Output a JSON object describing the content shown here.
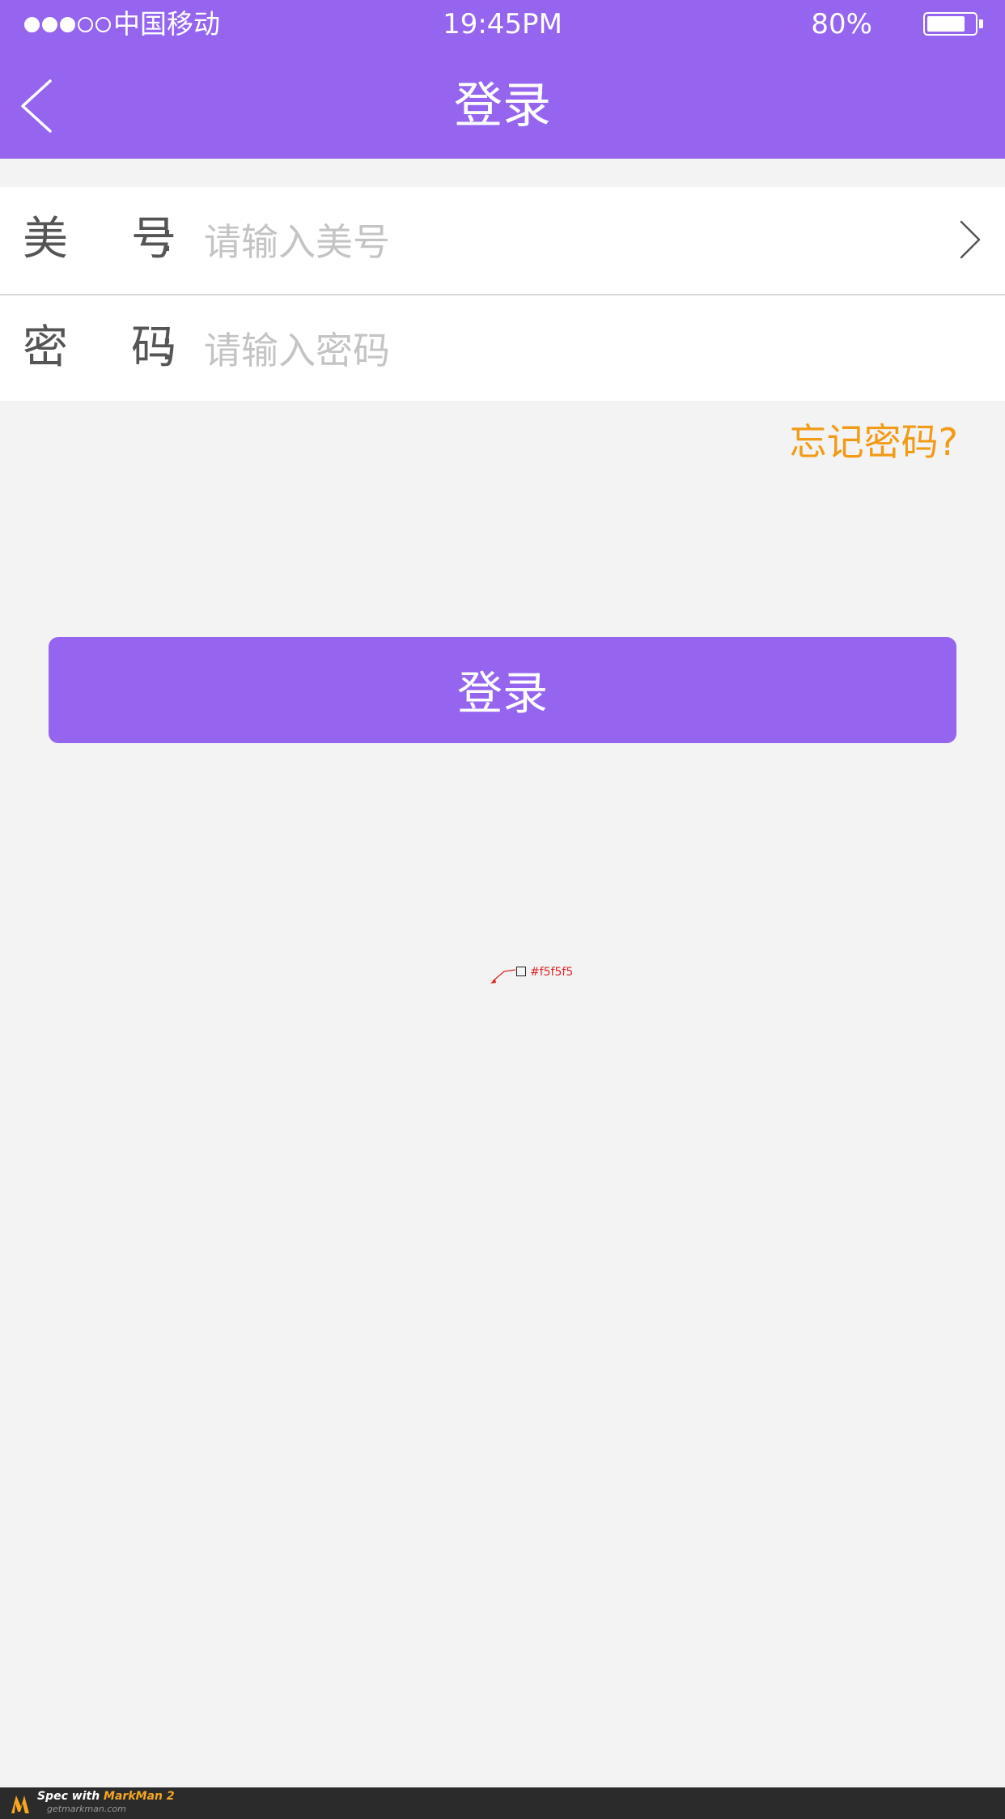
{
  "status_bar": {
    "signal_dots": "●●●○○",
    "carrier": "中国移动",
    "time": "19:45PM",
    "battery_text": "80%",
    "battery_level": 0.8
  },
  "nav": {
    "title": "登录",
    "back_icon": "chevron-left-icon"
  },
  "form": {
    "account": {
      "label_chars": [
        "美",
        "号"
      ],
      "colon": ":",
      "placeholder": "请输入美号",
      "trailing_icon": "chevron-right-icon"
    },
    "password": {
      "label_chars": [
        "密",
        "码"
      ],
      "colon": ":",
      "placeholder": "请输入密码"
    }
  },
  "forgot_password": "忘记密码?",
  "login_button": "登录",
  "spec_annotation": {
    "color_label": "#f5f5f5"
  },
  "footer": {
    "spec_prefix": "Spec with",
    "brand": "MarkMan 2",
    "url": "getmarkman.com"
  },
  "colors": {
    "primary": "#9565ef",
    "accent_orange": "#f29b17",
    "background": "#f3f3f3",
    "annotation_red": "#e02424"
  }
}
